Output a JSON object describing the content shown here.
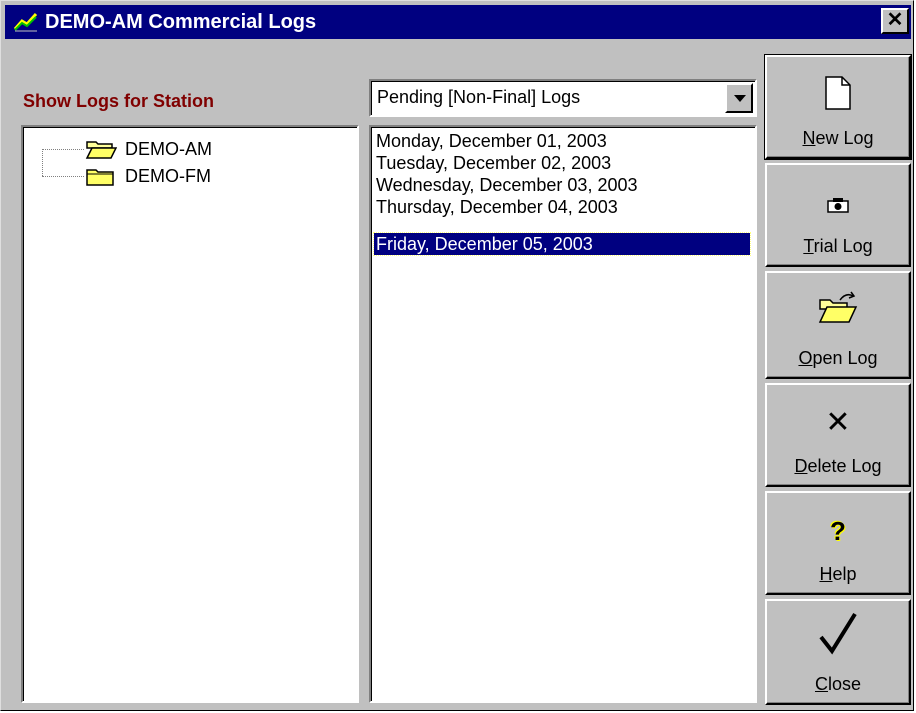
{
  "window": {
    "title": "DEMO-AM Commercial Logs",
    "close_glyph": "✕"
  },
  "station": {
    "label": "Show Logs for Station",
    "items": [
      {
        "label": "DEMO-AM",
        "icon": "open-folder-icon"
      },
      {
        "label": "DEMO-FM",
        "icon": "closed-folder-icon"
      }
    ]
  },
  "filter": {
    "selected": "Pending [Non-Final] Logs"
  },
  "logs": {
    "items": [
      "Monday, December 01, 2003",
      "Tuesday, December 02, 2003",
      "Wednesday, December 03, 2003",
      "Thursday, December 04, 2003",
      "Friday, December 05, 2003"
    ],
    "selected_index": 4
  },
  "buttons": {
    "new_log": {
      "mnemonic": "N",
      "rest": "ew Log",
      "icon": "new-document-icon"
    },
    "trial_log": {
      "mnemonic": "T",
      "rest": "rial Log",
      "icon": "camera-icon"
    },
    "open_log": {
      "mnemonic": "O",
      "rest": "pen Log",
      "icon": "open-folder-icon"
    },
    "delete_log": {
      "mnemonic": "D",
      "rest": "elete Log",
      "icon": "delete-x-icon",
      "glyph": "✕"
    },
    "help": {
      "mnemonic": "H",
      "rest": "elp",
      "icon": "question-mark-icon",
      "glyph": "?"
    },
    "close": {
      "mnemonic": "C",
      "rest": "lose",
      "icon": "checkmark-icon"
    }
  },
  "colors": {
    "titlebar": "#000080",
    "station_label": "#800000",
    "selection": "#000080",
    "face": "#c0c0c0"
  }
}
